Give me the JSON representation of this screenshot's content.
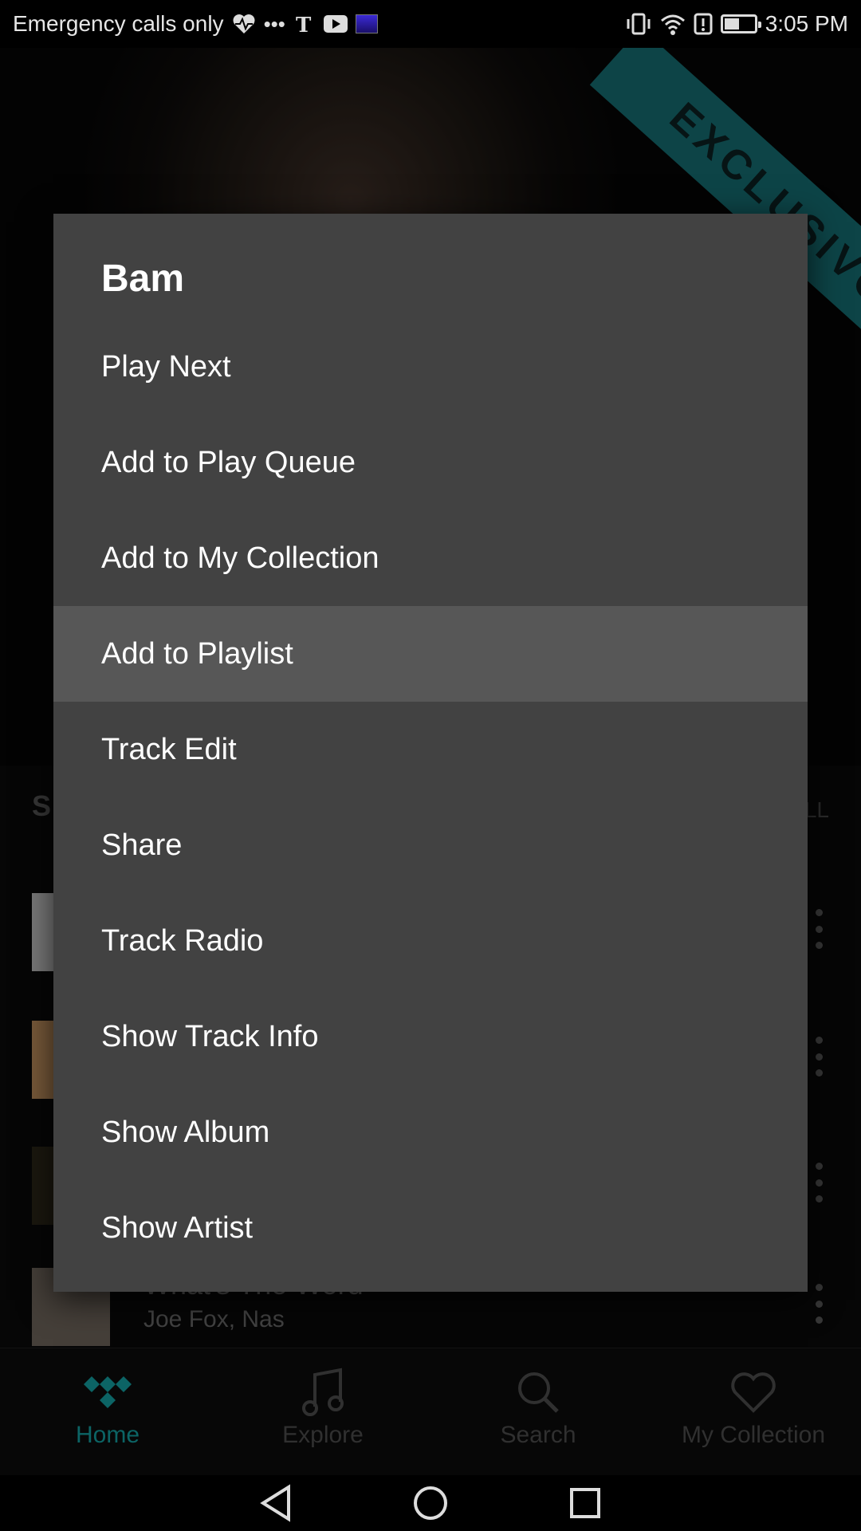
{
  "status_bar": {
    "carrier_text": "Emergency calls only",
    "overflow_dots": "•••",
    "time": "3:05 PM",
    "icons": [
      "heart-pulse-icon",
      "nytimes-icon",
      "youtube-icon",
      "cast-thumbnail-icon",
      "vibrate-icon",
      "wifi-icon",
      "alert-icon",
      "battery-icon"
    ]
  },
  "background": {
    "banner_badge": "EXCLUSIVO",
    "section_header": "S",
    "view_all": "LL",
    "tracks": [
      {
        "title": "",
        "artist": ""
      },
      {
        "title": "",
        "artist": ""
      },
      {
        "title": "",
        "artist": ""
      },
      {
        "title": "What's The Word",
        "artist": "Joe Fox, Nas"
      }
    ]
  },
  "context_menu": {
    "title": "Bam",
    "items": [
      {
        "label": "Play Next",
        "highlighted": false
      },
      {
        "label": "Add to Play Queue",
        "highlighted": false
      },
      {
        "label": "Add to My Collection",
        "highlighted": false
      },
      {
        "label": "Add to Playlist",
        "highlighted": true
      },
      {
        "label": "Track Edit",
        "highlighted": false
      },
      {
        "label": "Share",
        "highlighted": false
      },
      {
        "label": "Track Radio",
        "highlighted": false
      },
      {
        "label": "Show Track Info",
        "highlighted": false
      },
      {
        "label": "Show Album",
        "highlighted": false
      },
      {
        "label": "Show Artist",
        "highlighted": false
      }
    ]
  },
  "bottom_nav": {
    "items": [
      {
        "label": "Home",
        "icon": "tidal-home-icon",
        "active": true
      },
      {
        "label": "Explore",
        "icon": "music-note-icon",
        "active": false
      },
      {
        "label": "Search",
        "icon": "search-icon",
        "active": false
      },
      {
        "label": "My Collection",
        "icon": "heart-icon",
        "active": false
      }
    ]
  },
  "system_nav": {
    "icons": [
      "back-icon",
      "home-circle-icon",
      "recents-icon"
    ]
  },
  "colors": {
    "accent": "#139a9c",
    "menu_bg": "#424242",
    "menu_highlight": "#575757",
    "ribbon": "#1ea7ad"
  }
}
